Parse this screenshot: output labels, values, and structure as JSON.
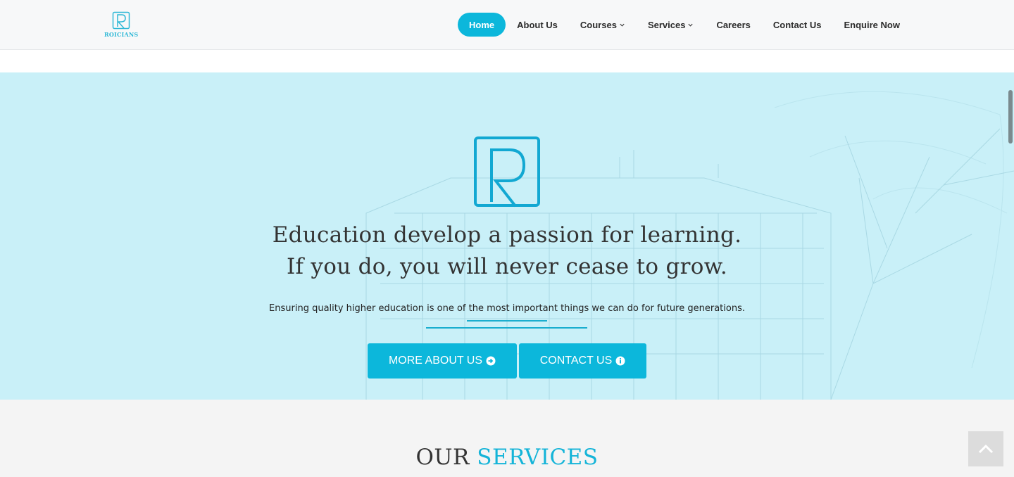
{
  "brand": {
    "logo_text": "ROICIANS",
    "accent": "#0cb7db"
  },
  "nav": {
    "items": [
      {
        "label": "Home",
        "active": true
      },
      {
        "label": "About Us"
      },
      {
        "label": "Courses",
        "dropdown": true
      },
      {
        "label": "Services",
        "dropdown": true
      },
      {
        "label": "Careers"
      },
      {
        "label": "Contact Us"
      },
      {
        "label": "Enquire Now"
      }
    ]
  },
  "hero": {
    "headline_line1": "Education develop a passion for learning.",
    "headline_line2": "If you do, you will never cease to grow.",
    "subtitle": "Ensuring quality higher education is one of the most important things we can do for future generations.",
    "buttons": {
      "about_label": "MORE ABOUT US",
      "about_icon": "arrow-circle-right-icon",
      "contact_label": "CONTACT US",
      "contact_icon": "info-circle-icon"
    }
  },
  "services": {
    "title_part1": "OUR",
    "title_part2": "SERVICES"
  },
  "icons": {
    "back_to_top": "chevron-up-icon"
  }
}
